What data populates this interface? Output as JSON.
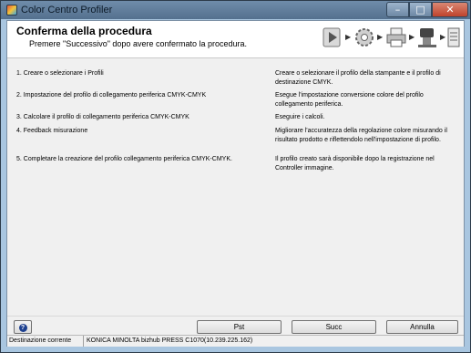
{
  "window": {
    "title": "Color Centro Profiler"
  },
  "header": {
    "title": "Conferma della procedura",
    "subtitle": "Premere \"Successivo\" dopo avere confermato la procedura.",
    "step_icons": [
      "play-step-icon",
      "gear-step-icon",
      "printer-step-icon",
      "measure-step-icon",
      "profile-step-icon"
    ]
  },
  "steps": [
    {
      "label": "1. Creare o selezionare i Profili",
      "desc": "Creare o selezionare il profilo della stampante e il profilo di destinazione CMYK."
    },
    {
      "label": "2. Impostazione del profilo di collegamento periferica CMYK-CMYK",
      "desc": "Esegue l'impostazione conversione colore del profilo collegamento periferica."
    },
    {
      "label": "3. Calcolare il profilo di collegamento periferica CMYK-CMYK",
      "desc": "Eseguire i calcoli."
    },
    {
      "label": "4. Feedback misurazione",
      "desc": "Migliorare l'accuratezza della regolazione colore misurando il risultato prodotto e riflettendolo nell'impostazione di profilo."
    },
    {
      "label": "5. Completare la creazione del profilo collegamento periferica CMYK-CMYK.",
      "desc": "Il profilo creato sarà disponibile dopo la registrazione nel Controller immagine."
    }
  ],
  "buttons": {
    "prev": "Pst",
    "next": "Succ",
    "cancel": "Annulla"
  },
  "status": {
    "label": "Destinazione corrente",
    "value": "KONICA MINOLTA bizhub PRESS C1070(10.239.225.162)"
  }
}
